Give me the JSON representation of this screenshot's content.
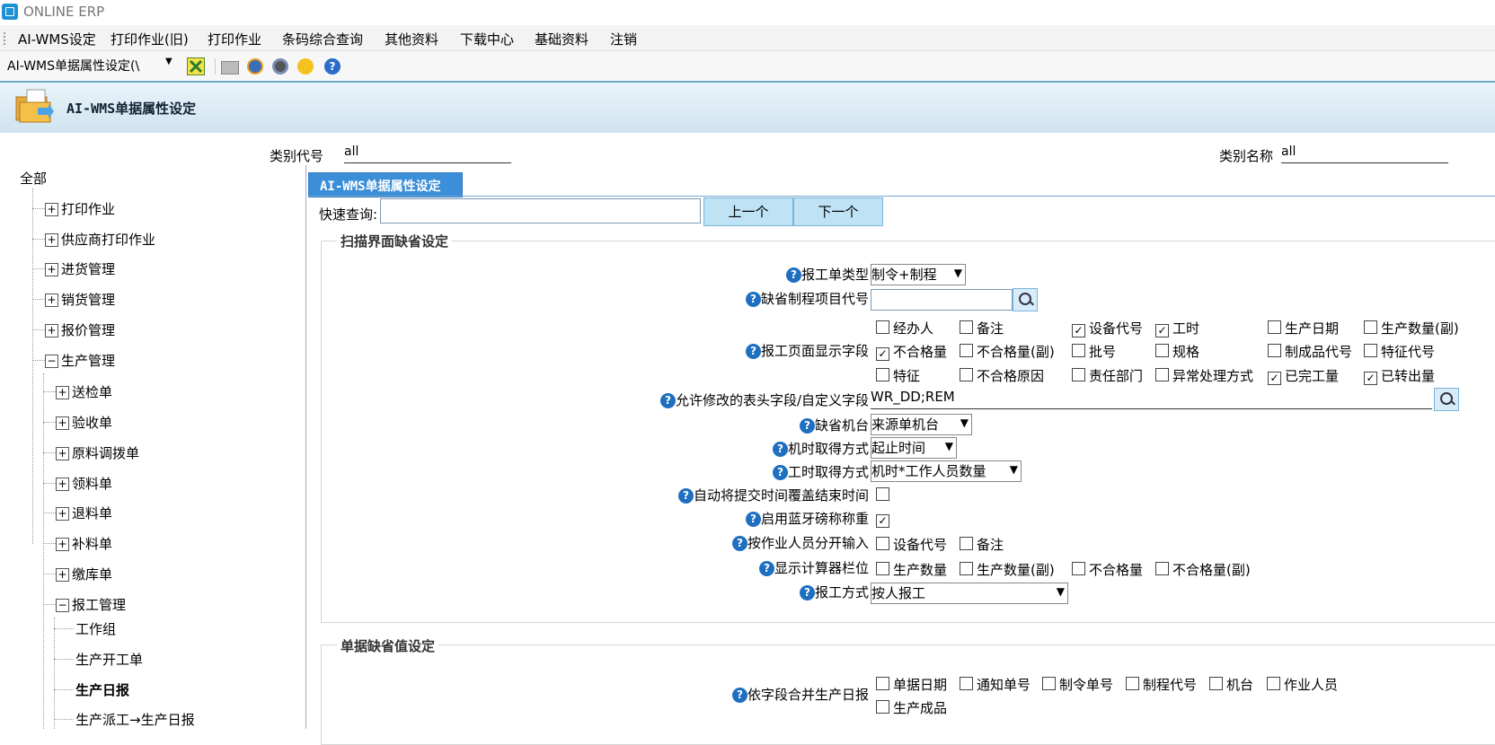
{
  "window": {
    "title": "ONLINE ERP"
  },
  "menu": [
    "AI-WMS设定",
    "打印作业(旧)",
    "打印作业",
    "条码综合查询",
    "其他资料",
    "下载中心",
    "基础资料",
    "注销"
  ],
  "toolbar": {
    "module_select": "AI-WMS单据属性设定(\\"
  },
  "banner": {
    "title": "AI-WMS单据属性设定"
  },
  "category": {
    "code_label": "类别代号",
    "code_value": "all",
    "name_label": "类别名称",
    "name_value": "all"
  },
  "tree": {
    "root": "全部",
    "top": [
      "打印作业",
      "供应商打印作业",
      "进货管理",
      "销货管理",
      "报价管理",
      "生产管理"
    ],
    "production": [
      "送检单",
      "验收单",
      "原料调拨单",
      "领料单",
      "退料单",
      "补料单",
      "缴库单",
      "报工管理"
    ],
    "report": [
      "工作组",
      "生产开工单",
      "生产日报",
      "生产派工→生产日报"
    ]
  },
  "tab": {
    "label": "AI-WMS单据属性设定"
  },
  "quicksearch": {
    "label": "快速查询:",
    "prev": "上一个",
    "next": "下一个"
  },
  "section1": {
    "legend": "扫描界面缺省设定",
    "report_type_label": "报工单类型",
    "report_type_value": "制令+制程",
    "default_process_label": "缺省制程项目代号",
    "display_fields_label": "报工页面显示字段",
    "display_fields": [
      {
        "label": "经办人",
        "checked": false
      },
      {
        "label": "备注",
        "checked": false
      },
      {
        "label": "设备代号",
        "checked": true
      },
      {
        "label": "工时",
        "checked": true
      },
      {
        "label": "生产日期",
        "checked": false
      },
      {
        "label": "生产数量(副)",
        "checked": false
      },
      {
        "label": "不合格量",
        "checked": true
      },
      {
        "label": "不合格量(副)",
        "checked": false
      },
      {
        "label": "批号",
        "checked": false
      },
      {
        "label": "规格",
        "checked": false
      },
      {
        "label": "制成品代号",
        "checked": false
      },
      {
        "label": "特征代号",
        "checked": false
      },
      {
        "label": "特征",
        "checked": false
      },
      {
        "label": "不合格原因",
        "checked": false
      },
      {
        "label": "责任部门",
        "checked": false
      },
      {
        "label": "异常处理方式",
        "checked": false
      },
      {
        "label": "已完工量",
        "checked": true
      },
      {
        "label": "已转出量",
        "checked": true
      }
    ],
    "editable_fields_label": "允许修改的表头字段/自定义字段",
    "editable_fields_value": "WR_DD;REM",
    "default_machine_label": "缺省机台",
    "default_machine_value": "来源单机台",
    "machine_time_label": "机时取得方式",
    "machine_time_value": "起止时间",
    "work_time_label": "工时取得方式",
    "work_time_value": "机时*工作人员数量",
    "auto_cover_label": "自动将提交时间覆盖结束时间",
    "bluetooth_label": "启用蓝牙磅称称重",
    "split_input_label": "按作业人员分开输入",
    "split_input_options": [
      {
        "label": "设备代号",
        "checked": false
      },
      {
        "label": "备注",
        "checked": false
      }
    ],
    "calculator_label": "显示计算器栏位",
    "calculator_options": [
      {
        "label": "生产数量",
        "checked": false
      },
      {
        "label": "生产数量(副)",
        "checked": false
      },
      {
        "label": "不合格量",
        "checked": false
      },
      {
        "label": "不合格量(副)",
        "checked": false
      }
    ],
    "report_mode_label": "报工方式",
    "report_mode_value": "按人报工"
  },
  "section2": {
    "legend": "单据缺省值设定",
    "merge_label": "依字段合并生产日报",
    "merge_options": [
      {
        "label": "单据日期",
        "checked": false
      },
      {
        "label": "通知单号",
        "checked": false
      },
      {
        "label": "制令单号",
        "checked": false
      },
      {
        "label": "制程代号",
        "checked": false
      },
      {
        "label": "机台",
        "checked": false
      },
      {
        "label": "作业人员",
        "checked": false
      },
      {
        "label": "生产成品",
        "checked": false
      }
    ]
  }
}
